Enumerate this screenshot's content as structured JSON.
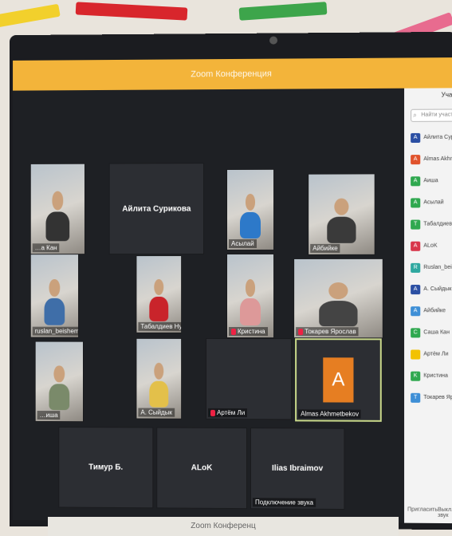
{
  "window": {
    "title": "Zoom Конференция"
  },
  "taskbar": {
    "title": "Zoom Конференц"
  },
  "tiles": {
    "kan": "…а Кан",
    "ailita": "Айлита Сурикова",
    "asylai": "Асылай",
    "aibike": "Айбийке",
    "ruslan": "ruslan_beishembiev",
    "tabaldiev": "Табалдиев Нурлан",
    "kristina": "Кристина",
    "tokarev": "Токарев Ярослав",
    "aisha": "…иша",
    "sydyk": "А. Сыйдык",
    "artem": "Артём Ли",
    "almas": "Almas Akhmetbekov",
    "almas_initial": "A",
    "timur": "Тимур Б.",
    "alok": "ALoK",
    "ilias": "Ilias Ibraimov",
    "audio_connecting": "Подключение звука"
  },
  "sidebar": {
    "title": "Уча",
    "search_placeholder": "Найти участник",
    "items": [
      {
        "initial": "A",
        "name": "Айлита Сури",
        "color": "#2b4fa3"
      },
      {
        "initial": "A",
        "name": "Almas Akhmet",
        "color": "#e0522b"
      },
      {
        "initial": "A",
        "name": "Аиша",
        "color": "#2fa84f"
      },
      {
        "initial": "A",
        "name": "Асылай",
        "color": "#2fa84f"
      },
      {
        "initial": "T",
        "name": "Табалдиев Нурла",
        "color": "#2fa84f"
      },
      {
        "initial": "A",
        "name": "ALoK",
        "color": "#d8354a"
      },
      {
        "initial": "R",
        "name": "Ruslan_beishemb",
        "color": "#2fa8a0"
      },
      {
        "initial": "A",
        "name": "А. Сыйдык",
        "color": "#2b4fa3"
      },
      {
        "initial": "A",
        "name": "Айбийке",
        "color": "#3e8fd6"
      },
      {
        "initial": "C",
        "name": "Саша Кан",
        "color": "#2fa84f"
      },
      {
        "initial": "",
        "name": "Артём Ли",
        "color": "#f2c200"
      },
      {
        "initial": "K",
        "name": "Кристина",
        "color": "#2fa84f"
      },
      {
        "initial": "T",
        "name": "Токарев Яросла",
        "color": "#3e8fd6"
      }
    ],
    "invite": "Пригласить",
    "mute_all": "Выкл. звук"
  }
}
